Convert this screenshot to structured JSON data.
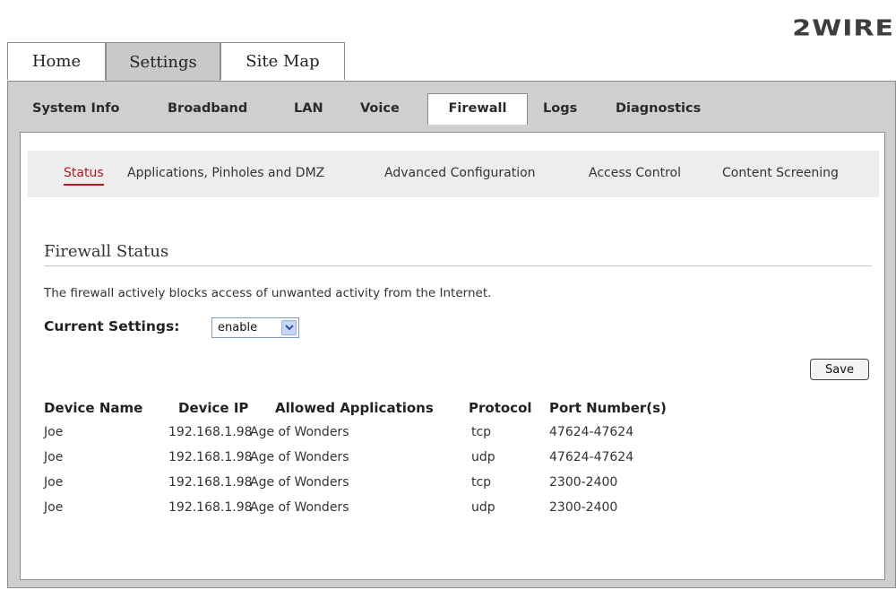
{
  "brand": {
    "logo_text": "2WIRE"
  },
  "top_tabs": [
    {
      "label": "Home",
      "active": false
    },
    {
      "label": "Settings",
      "active": true
    },
    {
      "label": "Site Map",
      "active": false
    }
  ],
  "sub_tabs": [
    {
      "label": "System Info"
    },
    {
      "label": "Broadband"
    },
    {
      "label": "LAN"
    },
    {
      "label": "Voice"
    },
    {
      "label": "Firewall",
      "active": true
    },
    {
      "label": "Logs"
    },
    {
      "label": "Diagnostics"
    }
  ],
  "subnav": [
    {
      "label": "Status",
      "active": true
    },
    {
      "label": "Applications, Pinholes and DMZ"
    },
    {
      "label": "Advanced Configuration"
    },
    {
      "label": "Access Control"
    },
    {
      "label": "Content Screening"
    }
  ],
  "section": {
    "title": "Firewall Status",
    "description": "The firewall actively blocks access of unwanted activity from the Internet."
  },
  "settings": {
    "current_label": "Current Settings:",
    "current_value": "enable"
  },
  "buttons": {
    "save": "Save"
  },
  "table": {
    "headers": [
      "Device Name",
      "Device IP",
      "Allowed Applications",
      "Protocol",
      "Port Number(s)"
    ],
    "rows": [
      [
        "Joe",
        "192.168.1.98",
        "Age of Wonders",
        "tcp",
        "47624-47624"
      ],
      [
        "Joe",
        "192.168.1.98",
        "Age of Wonders",
        "udp",
        "47624-47624"
      ],
      [
        "Joe",
        "192.168.1.98",
        "Age of Wonders",
        "tcp",
        "2300-2400"
      ],
      [
        "Joe",
        "192.168.1.98",
        "Age of Wonders",
        "udp",
        "2300-2400"
      ]
    ]
  },
  "icons": {
    "dropdown": "chevron-down-icon"
  },
  "colors": {
    "active_link": "#b21a1a",
    "frame_gray": "#cfcfcf",
    "select_arrow": "#c6d8f7"
  }
}
